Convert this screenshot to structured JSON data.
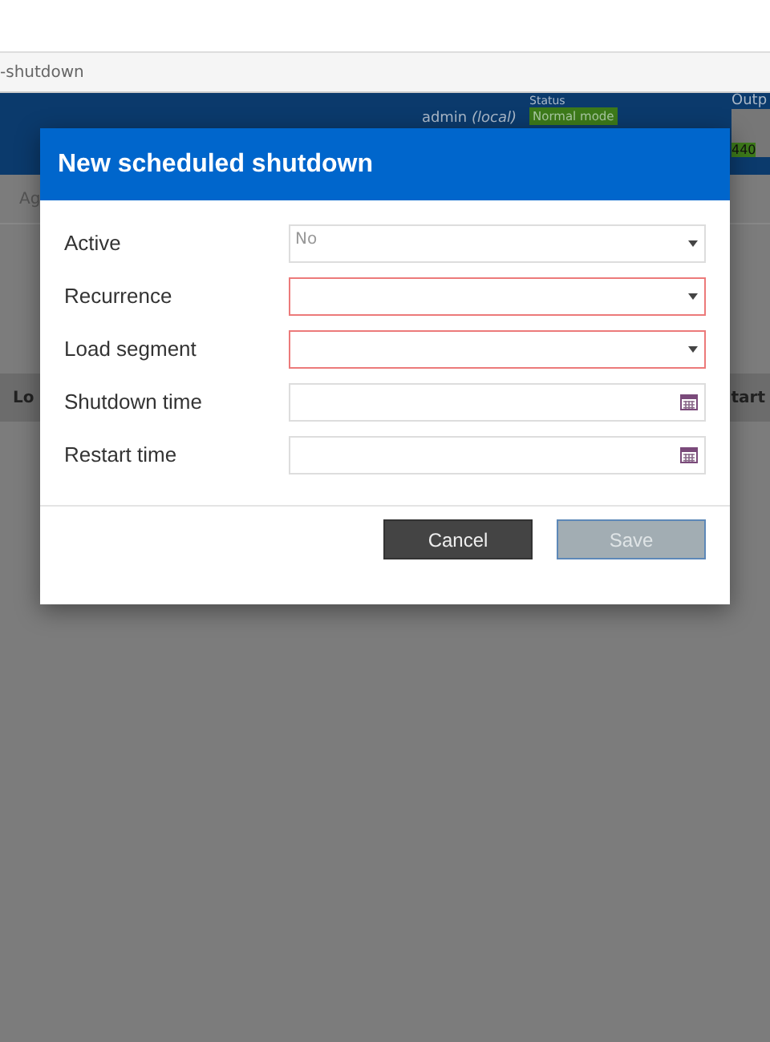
{
  "browser": {
    "address": "-shutdown"
  },
  "header": {
    "user": "admin *(local)*",
    "status_label": "Status",
    "status": "Normal mode",
    "output_label": "Outp",
    "output_value": "440"
  },
  "page": {
    "tab": "Ag",
    "table_columns": [
      "Lo",
      "tart"
    ]
  },
  "dialog": {
    "title": "New scheduled shutdown",
    "fields": [
      {
        "label": "Active",
        "kind": "select",
        "value": "No",
        "invalid": false
      },
      {
        "label": "Recurrence",
        "kind": "select",
        "invalid": true
      },
      {
        "label": "Load segment",
        "kind": "select",
        "invalid": true
      },
      {
        "label": "Shutdown time",
        "kind": "datetime",
        "invalid": false
      },
      {
        "label": "Restart time",
        "kind": "datetime",
        "invalid": false
      }
    ],
    "buttons": [
      {
        "label": "Cancel",
        "kind": "secondary",
        "disabled": false
      },
      {
        "label": "Save",
        "kind": "primary",
        "disabled": true
      }
    ]
  }
}
